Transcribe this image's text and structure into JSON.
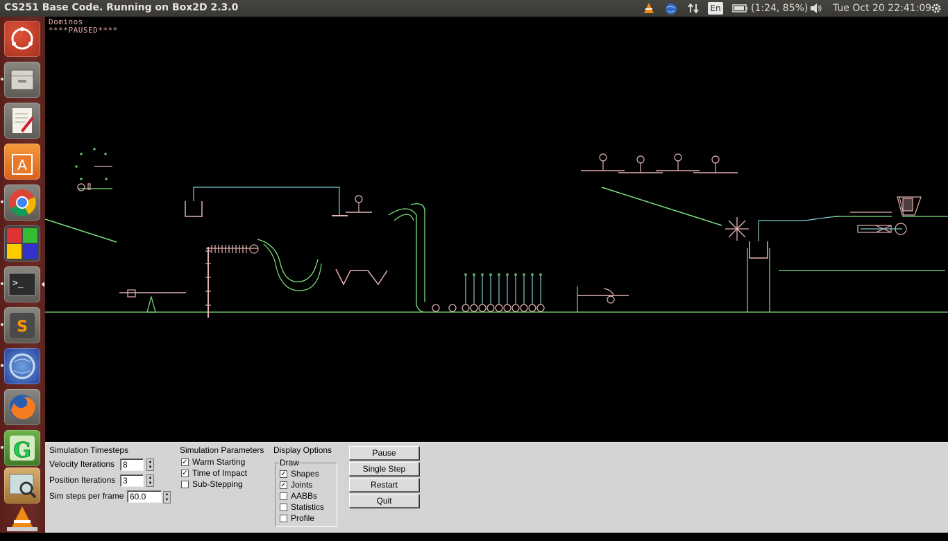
{
  "window_title": "CS251 Base Code. Running on Box2D 2.3.0",
  "indicators": {
    "keyboard": "En",
    "battery": "(1:24, 85%)",
    "clock": "Tue Oct 20 22:41:09"
  },
  "launcher": {
    "items": [
      "Ubuntu Dash",
      "Files",
      "Text Editor",
      "Ubuntu Software Center",
      "Google Chrome",
      "Workspace Switcher",
      "Terminal",
      "Sublime Text",
      "Unknown App",
      "Firefox",
      "Geany",
      "Image Viewer",
      "VLC"
    ]
  },
  "canvas": {
    "title": "Dominos",
    "status": "****PAUSED****"
  },
  "panel": {
    "timesteps": {
      "heading": "Simulation Timesteps",
      "velocity_label": "Velocity Iterations",
      "velocity_value": "8",
      "position_label": "Position Iterations",
      "position_value": "3",
      "hz_label": "Sim steps per frame",
      "hz_value": "60.0"
    },
    "params": {
      "heading": "Simulation Parameters",
      "warm_starting": "Warm Starting",
      "warm_starting_checked": true,
      "time_of_impact": "Time of Impact",
      "time_of_impact_checked": true,
      "sub_stepping": "Sub-Stepping",
      "sub_stepping_checked": false
    },
    "display": {
      "heading": "Display Options",
      "draw_label": "Draw",
      "shapes": "Shapes",
      "shapes_checked": true,
      "joints": "Joints",
      "joints_checked": true,
      "aabbs": "AABBs",
      "aabbs_checked": false,
      "statistics": "Statistics",
      "statistics_checked": false,
      "profile": "Profile",
      "profile_checked": false
    },
    "buttons": {
      "pause": "Pause",
      "single_step": "Single Step",
      "restart": "Restart",
      "quit": "Quit"
    }
  },
  "colors": {
    "static": "#7fe57f",
    "dynamic": "#e6b2b2",
    "joint": "#80cccc",
    "panel_bg": "#d4d4d4"
  }
}
